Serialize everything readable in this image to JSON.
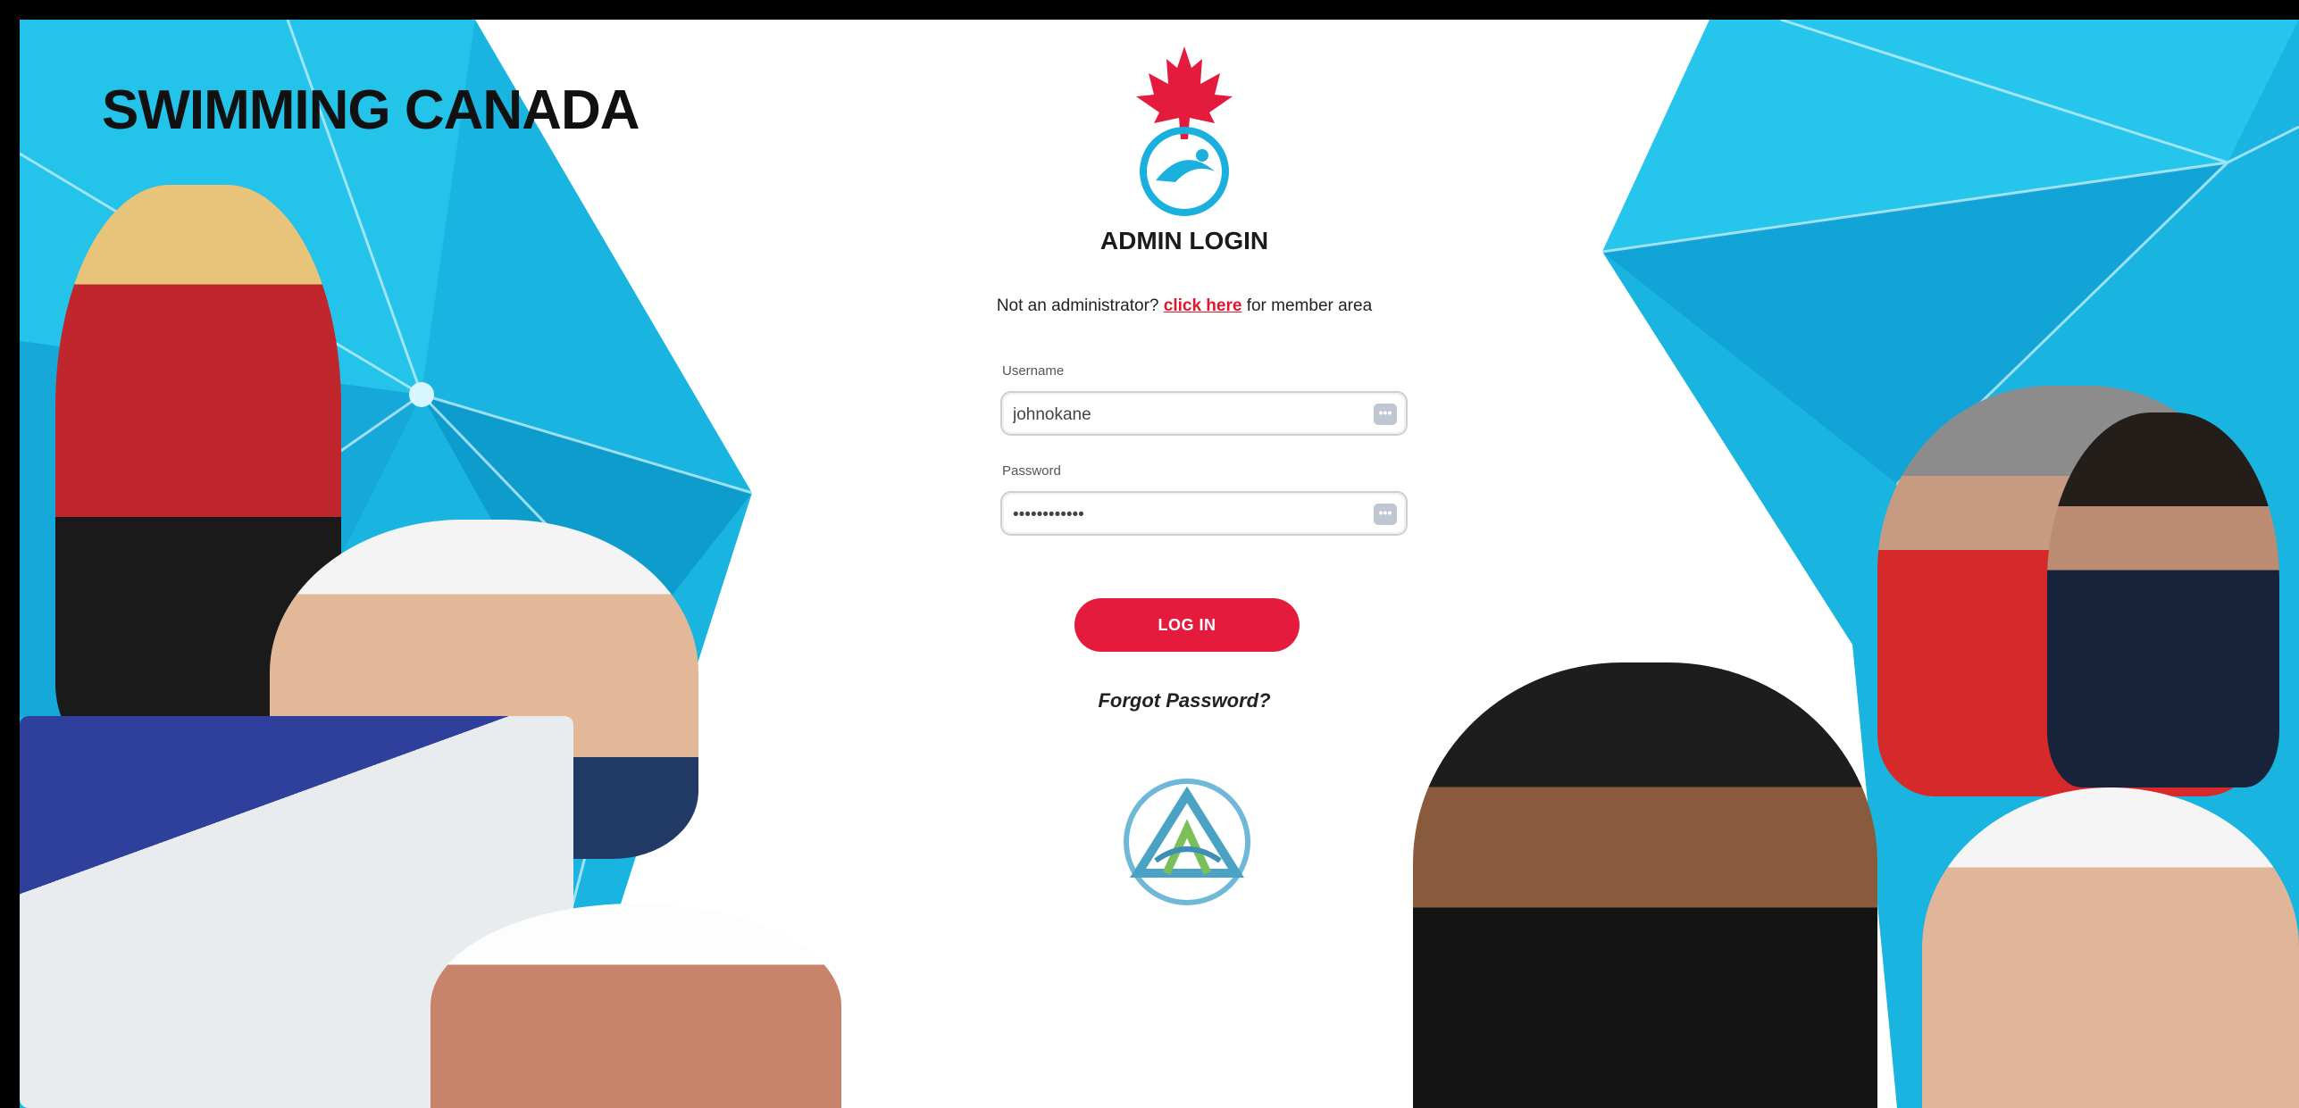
{
  "brand": {
    "name": "SWIMMING CANADA"
  },
  "login": {
    "title": "ADMIN LOGIN",
    "member_prompt_before": "Not an administrator? ",
    "member_link": "click here",
    "member_prompt_after": " for member area",
    "username_label": "Username",
    "username_value": "johnokane",
    "password_label": "Password",
    "password_value": "••••••••••••",
    "login_button": "LOG IN",
    "forgot_link": "Forgot Password?"
  },
  "colors": {
    "accent_red": "#e51b3d",
    "link_red": "#e0182d",
    "pool_blue": "#1ab0dd",
    "text_dark": "#1b1b1b"
  },
  "icons": {
    "logo": "maple-leaf-swimmer-logo",
    "password_manager": "password-manager-icon",
    "org_logo": "triangle-emblem-logo"
  }
}
